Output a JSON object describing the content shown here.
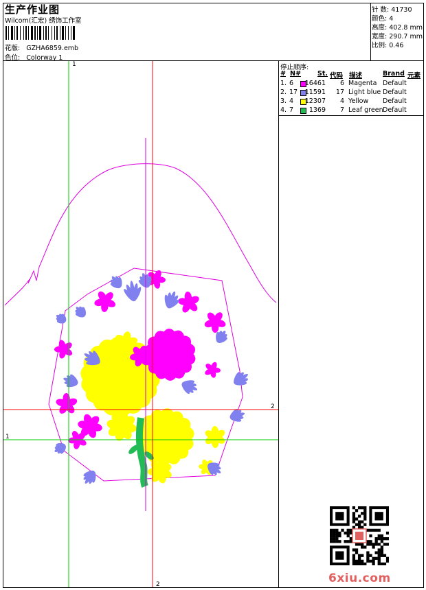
{
  "header": {
    "title": "生产作业图",
    "subtitle": "Wilcom(汇宏) 绣饰工作室",
    "file_label": "花版:",
    "file_value": "GZHA6859.emb",
    "color_label": "色位:",
    "color_value": "Colorway 1"
  },
  "stats": [
    {
      "label": "针 数:",
      "value": "41730"
    },
    {
      "label": "颜色:",
      "value": "4"
    },
    {
      "label": "高度:",
      "value": "402.8 mm"
    },
    {
      "label": "宽度:",
      "value": "290.7 mm"
    },
    {
      "label": "比例:",
      "value": "0.46"
    }
  ],
  "stop_sequence": {
    "title": "停止顺序:",
    "columns": [
      "#",
      "N#",
      "St.",
      "代码",
      "描述",
      "Brand",
      "元素"
    ],
    "rows": [
      {
        "index": "1.",
        "needle": "6",
        "color": "#ff00ff",
        "stitches": "16461",
        "code": "6",
        "desc": "Magenta",
        "brand": "Default"
      },
      {
        "index": "2.",
        "needle": "17",
        "color": "#8080ee",
        "stitches": "11591",
        "code": "17",
        "desc": "Light blue",
        "brand": "Default"
      },
      {
        "index": "3.",
        "needle": "4",
        "color": "#ffff00",
        "stitches": "12307",
        "code": "4",
        "desc": "Yellow",
        "brand": "Default"
      },
      {
        "index": "4.",
        "needle": "7",
        "color": "#22bb55",
        "stitches": "1369",
        "code": "7",
        "desc": "Leaf green",
        "brand": "Default"
      }
    ]
  },
  "guides": {
    "green_label": "1",
    "red_label": "2",
    "green_color": "#00cc00",
    "red_color": "#ff0000",
    "outline_color": "#dd00dd"
  },
  "watermark": "6xiu.com"
}
